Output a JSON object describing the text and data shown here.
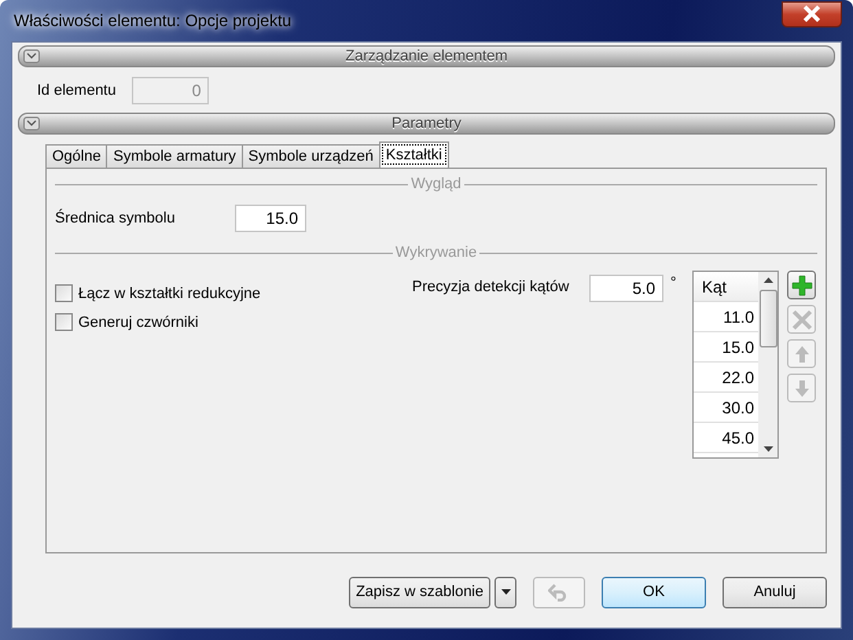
{
  "window": {
    "title": "Właściwości elementu: Opcje projektu"
  },
  "sections": [
    {
      "title": "Zarządzanie elementem",
      "expanded": true
    },
    {
      "title": "Parametry",
      "expanded": true
    }
  ],
  "id_field": {
    "label": "Id elementu",
    "value": "0",
    "disabled": true
  },
  "tabs": [
    {
      "label": "Ogólne",
      "selected": false
    },
    {
      "label": "Symbole armatury",
      "selected": false
    },
    {
      "label": "Symbole urządzeń",
      "selected": false
    },
    {
      "label": "Kształtki",
      "selected": true
    }
  ],
  "groups": [
    "Wygląd",
    "Wykrywanie"
  ],
  "diameter": {
    "label": "Średnica symbolu",
    "value": "15.0"
  },
  "checkboxes": [
    {
      "label": "Łącz w kształtki redukcyjne",
      "checked": false
    },
    {
      "label": "Generuj czwórniki",
      "checked": false
    }
  ],
  "precision": {
    "label": "Precyzja detekcji kątów",
    "value": "5.0",
    "unit": "°"
  },
  "angle_list": {
    "header": "Kąt",
    "rows": [
      "11.0",
      "15.0",
      "22.0",
      "30.0",
      "45.0"
    ]
  },
  "list_buttons": [
    {
      "kind": "add",
      "disabled": false
    },
    {
      "kind": "delete",
      "disabled": true
    },
    {
      "kind": "up",
      "disabled": true
    },
    {
      "kind": "down",
      "disabled": true
    }
  ],
  "footer": {
    "save_template": "Zapisz w szablonie",
    "undo_disabled": true,
    "ok": "OK",
    "cancel": "Anuluj"
  }
}
